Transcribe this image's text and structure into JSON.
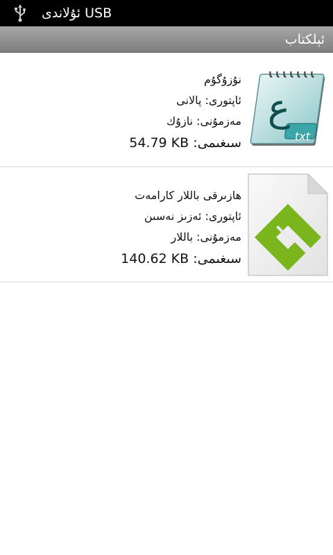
{
  "status_bar": {
    "icon": "usb-icon",
    "text": "ئۇلاندى USB"
  },
  "header": {
    "title": "ئېلكتاب"
  },
  "books": [
    {
      "title": "نۇزۇگۇم",
      "author": "ئاپتورى: پالانى",
      "category": "مەزمۇنى: نازۇك",
      "size_label": "سىغىمى:",
      "size_value": "54.79 KB",
      "icon": "txt-file-icon",
      "icon_letter": "ع",
      "icon_caption": "txt"
    },
    {
      "title": "هازىرقى باللار كارامەت",
      "author": "ئاپتورى: ئەزىز نەسىن",
      "category": "مەزمۇنى: باللار",
      "size_label": "سىغىمى:",
      "size_value": "140.62 KB",
      "icon": "epub-file-icon"
    }
  ],
  "colors": {
    "status_bar_bg": "#000000",
    "title_bar_top": "#a6a6a6",
    "title_bar_bottom": "#7e7e7e",
    "epub_green": "#7ab51d",
    "txt_teal": "#3aa6a8"
  }
}
